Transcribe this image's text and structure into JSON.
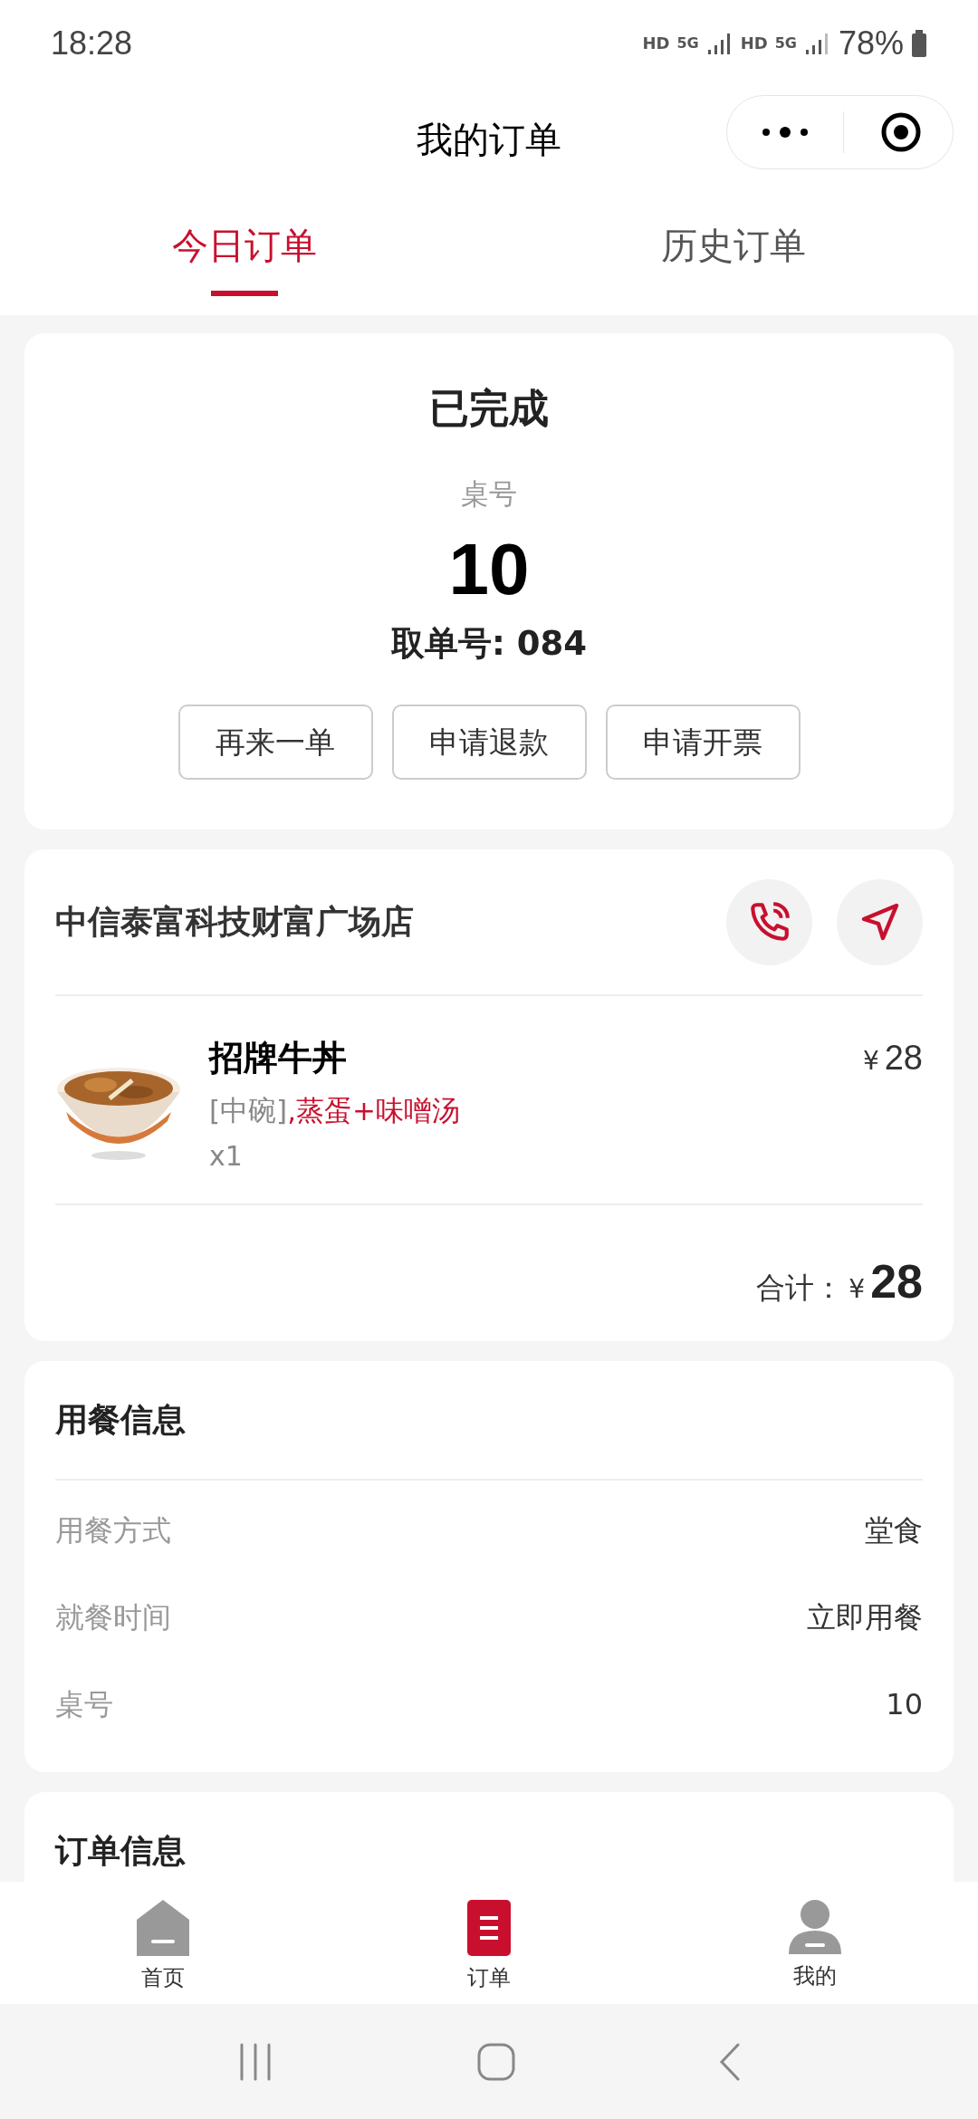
{
  "status_bar": {
    "time": "18:28",
    "network_1": "HD",
    "network_2": "5G",
    "network_3": "HD",
    "network_4": "5G",
    "battery": "78%"
  },
  "header": {
    "title": "我的订单"
  },
  "tabs": [
    {
      "label": "今日订单",
      "selected": true
    },
    {
      "label": "历史订单",
      "selected": false
    }
  ],
  "order_status": {
    "status": "已完成",
    "table_label": "桌号",
    "table_number": "10",
    "pickup": "取单号: 084",
    "buttons": [
      "再来一单",
      "申请退款",
      "申请开票"
    ]
  },
  "store": {
    "name": "中信泰富科技财富广场店",
    "items": [
      {
        "name": "招牌牛丼",
        "options": "[中碗]",
        "extras": ",蒸蛋+味噌汤",
        "quantity": "x1",
        "currency": "¥",
        "price": "28"
      }
    ],
    "total_label": "合计：",
    "total_currency": "¥",
    "total": "28"
  },
  "dining_info": {
    "title": "用餐信息",
    "rows": [
      {
        "label": "用餐方式",
        "value": "堂食"
      },
      {
        "label": "就餐时间",
        "value": "立即用餐"
      },
      {
        "label": "桌号",
        "value": "10"
      }
    ]
  },
  "order_info": {
    "title": "订单信息"
  },
  "bottom_nav": [
    {
      "kind": "home",
      "label": "首页",
      "selected": false
    },
    {
      "kind": "orders",
      "label": "订单",
      "selected": true
    },
    {
      "kind": "profile",
      "label": "我的",
      "selected": false
    }
  ]
}
